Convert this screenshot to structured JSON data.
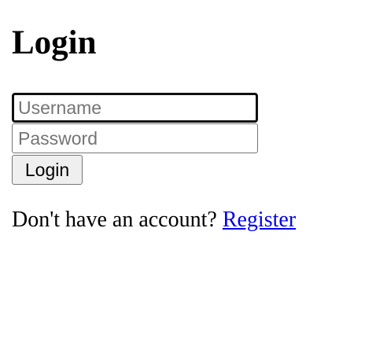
{
  "page": {
    "title": "Login"
  },
  "form": {
    "username": {
      "value": "",
      "placeholder": "Username"
    },
    "password": {
      "value": "",
      "placeholder": "Password"
    },
    "submit_label": "Login"
  },
  "register": {
    "prompt": "Don't have an account?",
    "link_label": "Register"
  },
  "colors": {
    "link": "#0000ee",
    "button_background": "#efefef",
    "placeholder": "#757575"
  }
}
